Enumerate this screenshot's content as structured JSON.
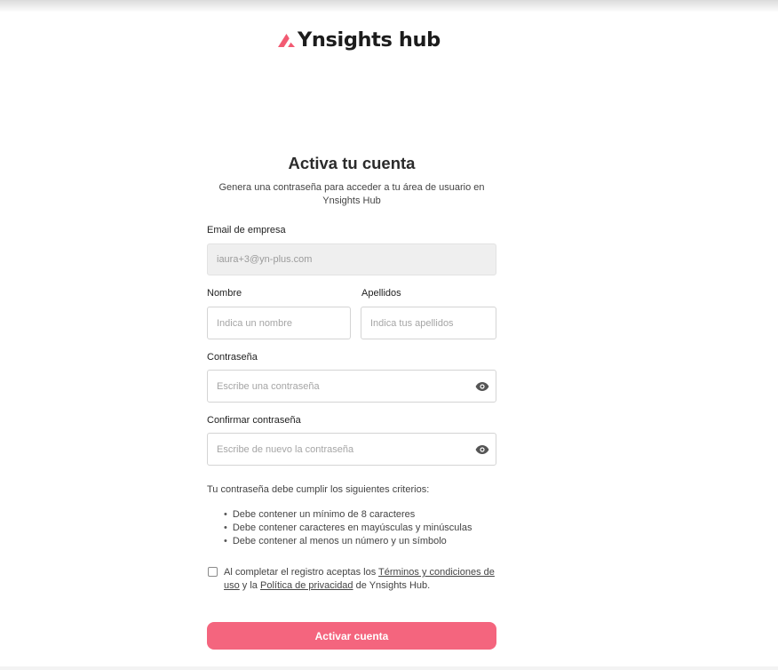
{
  "brand": {
    "name": "Ynsights hub",
    "accent_color": "#f4657e",
    "logo_icon": "triangle-logo-icon"
  },
  "page": {
    "title": "Activa tu cuenta",
    "subtitle_line1": "Genera una contraseña para acceder a tu área de usuario en",
    "subtitle_line2": "Ynsights Hub"
  },
  "form": {
    "email": {
      "label": "Email de empresa",
      "value": "iaura+3@yn-plus.com"
    },
    "first_name": {
      "label": "Nombre",
      "placeholder": "Indica un nombre"
    },
    "last_name": {
      "label": "Apellidos",
      "placeholder": "Indica tus apellidos"
    },
    "password": {
      "label": "Contraseña",
      "placeholder": "Escribe una contraseña",
      "toggle_icon": "eye-icon"
    },
    "confirm_password": {
      "label": "Confirmar contraseña",
      "placeholder": "Escribe de nuevo la contraseña",
      "toggle_icon": "eye-icon"
    }
  },
  "criteria": {
    "heading": "Tu contraseña debe cumplir los siguientes criterios:",
    "items": [
      "Debe contener un mínimo de 8 caracteres",
      "Debe contener caracteres en mayúsculas y minúsculas",
      "Debe contener al menos un número y un símbolo"
    ]
  },
  "terms": {
    "checked": false,
    "text_before": "Al completar el registro aceptas los ",
    "terms_link": "Términos y condiciones de uso",
    "text_middle": " y la ",
    "privacy_link": "Política de privacidad",
    "text_after": " de Ynsights Hub."
  },
  "submit": {
    "label": "Activar cuenta"
  }
}
